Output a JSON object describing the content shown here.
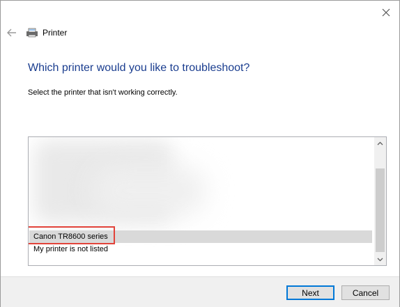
{
  "window": {
    "title": "Printer",
    "close_icon": "close-icon",
    "back_icon": "back-arrow-icon",
    "title_icon": "printer-icon"
  },
  "page": {
    "heading": "Which printer would you like to troubleshoot?",
    "instruction": "Select the printer that isn't working correctly."
  },
  "printer_list": {
    "items": [
      {
        "label": "Canon TR8600 series",
        "selected": true
      },
      {
        "label": "My printer is not listed",
        "selected": false
      }
    ]
  },
  "buttons": {
    "next": "Next",
    "cancel": "Cancel"
  },
  "colors": {
    "heading": "#1a3d8f",
    "highlight_border": "#e2433a",
    "default_button_border": "#0078d7"
  }
}
